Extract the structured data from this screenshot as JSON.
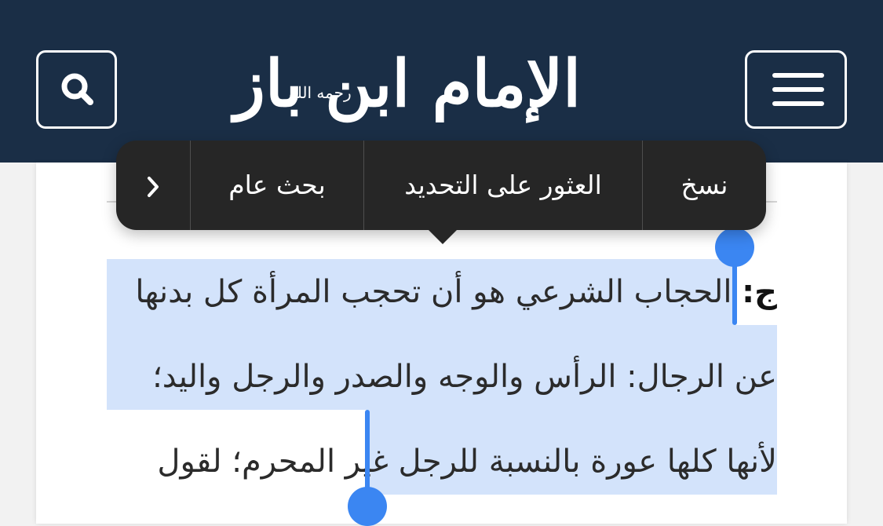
{
  "header": {
    "logo_title": "الإمام ابن باز",
    "logo_subtitle": "رحمه الله"
  },
  "context_menu": {
    "items": [
      {
        "label": "نسخ"
      },
      {
        "label": "العثور على التحديد"
      },
      {
        "label": "بحث عام"
      }
    ],
    "more_label": "›"
  },
  "article": {
    "answer_prefix": "ج:",
    "lines": [
      "الحجاب الشرعي هو أن تحجب المرأة كل بدنها",
      "عن الرجال: الرأس والوجه والصدر والرجل واليد؛",
      "لأنها كلها عورة بالنسبة للرجل",
      "غير المحرم؛ لقول"
    ]
  },
  "colors": {
    "header_bg": "#1a2e46",
    "selection": "#d3e3fb",
    "handle": "#3b86f2",
    "menu_bg": "#262626"
  }
}
